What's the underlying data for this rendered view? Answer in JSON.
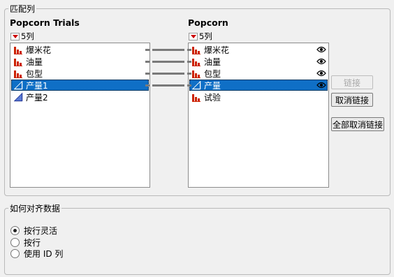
{
  "match_columns": {
    "group_label": "匹配列",
    "left": {
      "title": "Popcorn Trials",
      "count_label": "5列",
      "items": [
        {
          "label": "爆米花",
          "icon": "bar-chart-icon",
          "selected": false
        },
        {
          "label": "油量",
          "icon": "bar-chart-icon",
          "selected": false
        },
        {
          "label": "包型",
          "icon": "bar-chart-icon",
          "selected": false
        },
        {
          "label": "产量1",
          "icon": "continuous-triangle-icon",
          "selected": true
        },
        {
          "label": "产量2",
          "icon": "continuous-triangle-icon",
          "selected": false
        }
      ]
    },
    "right": {
      "title": "Popcorn",
      "count_label": "5列",
      "items": [
        {
          "label": "爆米花",
          "icon": "bar-chart-icon",
          "selected": false,
          "eye": true
        },
        {
          "label": "油量",
          "icon": "bar-chart-icon",
          "selected": false,
          "eye": true
        },
        {
          "label": "包型",
          "icon": "bar-chart-icon",
          "selected": false,
          "eye": true
        },
        {
          "label": "产量",
          "icon": "continuous-triangle-icon",
          "selected": true,
          "eye": true
        },
        {
          "label": "试验",
          "icon": "bar-chart-icon",
          "selected": false,
          "eye": false
        }
      ]
    },
    "buttons": {
      "link": "链接",
      "unlink": "取消链接",
      "unlink_all": "全部取消链接"
    }
  },
  "alignment": {
    "group_label": "如何对齐数据",
    "options": [
      {
        "label": "按行灵活",
        "checked": true
      },
      {
        "label": "按行",
        "checked": false
      },
      {
        "label": "使用 ID 列",
        "checked": false
      }
    ]
  },
  "colors": {
    "selection": "#0f6fc6",
    "nominal_icon": "#cc2200",
    "continuous_icon": "#2a3f9e"
  }
}
